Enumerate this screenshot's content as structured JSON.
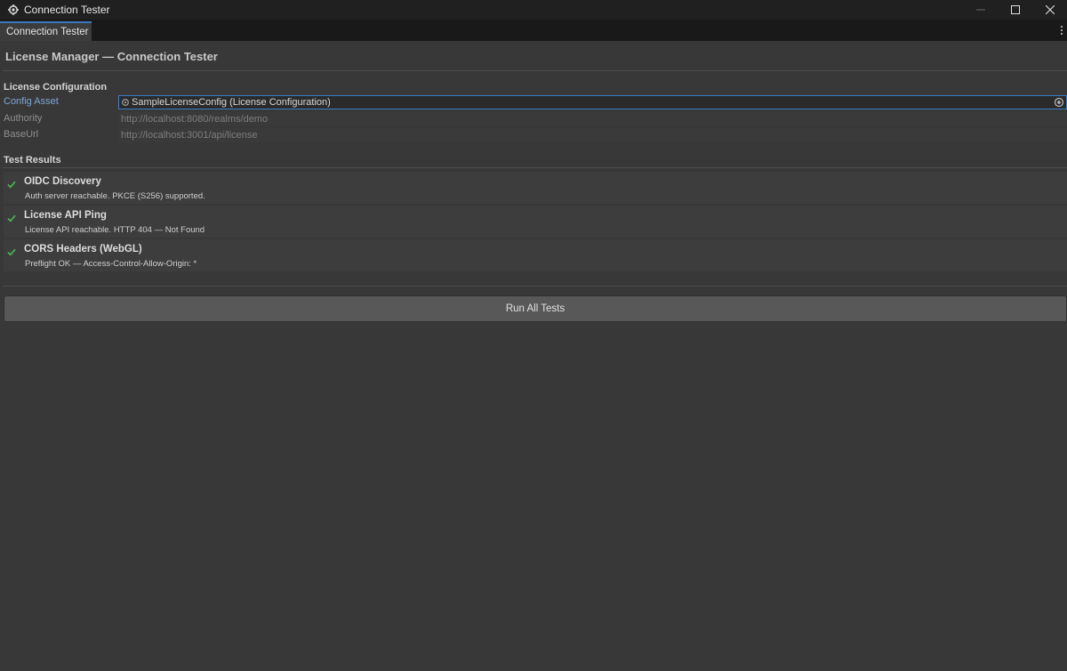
{
  "window": {
    "title": "Connection Tester",
    "icon": "unity-gear-icon",
    "controls": [
      "minimize-icon",
      "maximize-icon",
      "close-icon"
    ]
  },
  "tabs": [
    {
      "label": "Connection Tester",
      "active": true
    }
  ],
  "page": {
    "title": "License Manager — Connection Tester"
  },
  "license_config": {
    "heading": "License Configuration",
    "config_asset": {
      "label": "Config Asset",
      "value": "SampleLicenseConfig (License Configuration)"
    },
    "authority": {
      "label": "Authority",
      "value": "http://localhost:8080/realms/demo"
    },
    "base_url": {
      "label": "BaseUrl",
      "value": "http://localhost:3001/api/license"
    }
  },
  "test_results": {
    "heading": "Test Results",
    "items": [
      {
        "name": "OIDC Discovery",
        "detail": "Auth server reachable. PKCE (S256) supported.",
        "status": "pass"
      },
      {
        "name": "License API Ping",
        "detail": "License API reachable. HTTP 404 — Not Found",
        "status": "pass"
      },
      {
        "name": "CORS Headers (WebGL)",
        "detail": "Preflight OK — Access-Control-Allow-Origin: *",
        "status": "pass"
      }
    ]
  },
  "actions": {
    "run_all_label": "Run All Tests"
  },
  "colors": {
    "pass": "#4caf50",
    "accent": "#3d7cc7",
    "background": "#383838"
  }
}
